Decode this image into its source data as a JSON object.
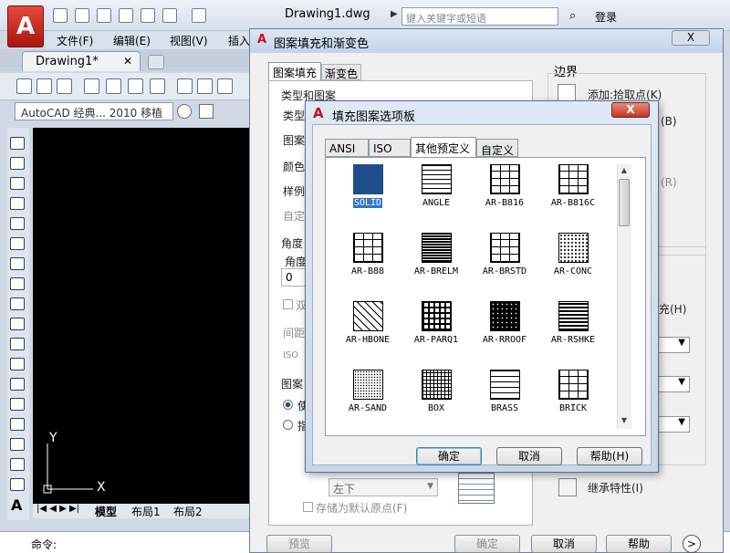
{
  "app": {
    "doc_title": "Drawing1.dwg",
    "search_placeholder": "键入关键字或短语",
    "login": "登录",
    "menus": [
      "文件(F)",
      "编辑(E)",
      "视图(V)",
      "插入"
    ],
    "doc_tab": "Drawing1*",
    "workspace": "AutoCAD 经典... 2010 移植",
    "layout_tabs": [
      "模型",
      "布局1",
      "布局2"
    ],
    "cmd_label": "命令:"
  },
  "back_dialog": {
    "title": "图案填充和渐变色",
    "close": "X",
    "tabs": [
      "图案填充",
      "渐变色"
    ],
    "labels": {
      "type_and_pattern": "类型和图案",
      "type": "类型",
      "pattern": "图案",
      "color": "颜色",
      "sample": "样例",
      "custom": "自定",
      "angle_scale": "角度",
      "angle": "角度",
      "angle_value": "0",
      "double": "双",
      "spacing": "间距",
      "iso": "ISO",
      "origin": "图案",
      "use_current": "使",
      "specify": "指",
      "bottom_left": "左下",
      "store_default": "存储为默认原点(F)",
      "border": "边界",
      "add_pick": "添加:拾取点(K)",
      "b_shortcut": "(B)",
      "r_shortcut": "(R)",
      "fill_h": "充(H)",
      "inherit": "继承特性(I)"
    },
    "buttons": {
      "preview": "预览",
      "ok": "确定",
      "cancel": "取消",
      "help": "帮助"
    }
  },
  "palette": {
    "title": "填充图案选项板",
    "close": "X",
    "tabs": [
      "ANSI",
      "ISO",
      "其他预定义",
      "自定义"
    ],
    "active_tab": "其他预定义",
    "patterns": [
      {
        "name": "SOLID",
        "kind": "solid",
        "selected": true
      },
      {
        "name": "ANGLE",
        "kind": "grid"
      },
      {
        "name": "AR-B816",
        "kind": "brick"
      },
      {
        "name": "AR-B816C",
        "kind": "brick"
      },
      {
        "name": "AR-B88",
        "kind": "brick"
      },
      {
        "name": "AR-BRELM",
        "kind": "dense"
      },
      {
        "name": "AR-BRSTD",
        "kind": "brick"
      },
      {
        "name": "AR-CONC",
        "kind": "dots"
      },
      {
        "name": "AR-HBONE",
        "kind": "diag"
      },
      {
        "name": "AR-PARQ1",
        "kind": "weave"
      },
      {
        "name": "AR-RROOF",
        "kind": "roof"
      },
      {
        "name": "AR-RSHKE",
        "kind": "shake"
      },
      {
        "name": "AR-SAND",
        "kind": "sand"
      },
      {
        "name": "BOX",
        "kind": "box"
      },
      {
        "name": "BRASS",
        "kind": "lines"
      },
      {
        "name": "BRICK",
        "kind": "brick"
      }
    ],
    "buttons": {
      "ok": "确定",
      "cancel": "取消",
      "help": "帮助(H)"
    }
  },
  "colors": {
    "accent": "#3276c3",
    "solid_fill": "#1f4e8c",
    "close_red": "#c23823"
  }
}
